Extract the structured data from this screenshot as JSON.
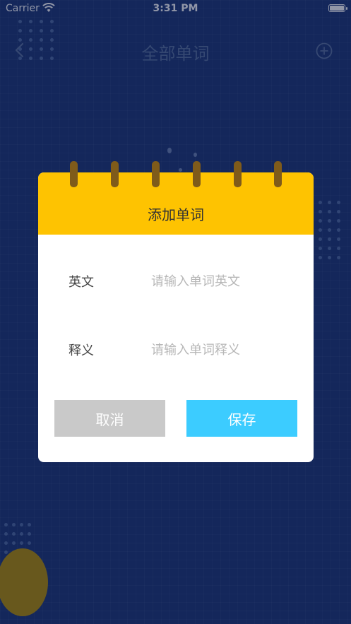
{
  "status_bar": {
    "carrier": "Carrier",
    "time": "3:31 PM"
  },
  "nav": {
    "title": "全部单词",
    "back_icon": "chevron-left-icon",
    "add_icon": "plus-circle-icon"
  },
  "dialog": {
    "title": "添加单词",
    "fields": [
      {
        "label": "英文",
        "placeholder": "请输入单词英文",
        "value": ""
      },
      {
        "label": "释义",
        "placeholder": "请输入单词释义",
        "value": ""
      }
    ],
    "cancel_label": "取消",
    "save_label": "保存"
  },
  "colors": {
    "background": "#1c3676",
    "dialog_header": "#fec301",
    "cancel_button": "#c9c9c9",
    "save_button": "#3cccff",
    "binder_ring": "#7f5b1a"
  }
}
